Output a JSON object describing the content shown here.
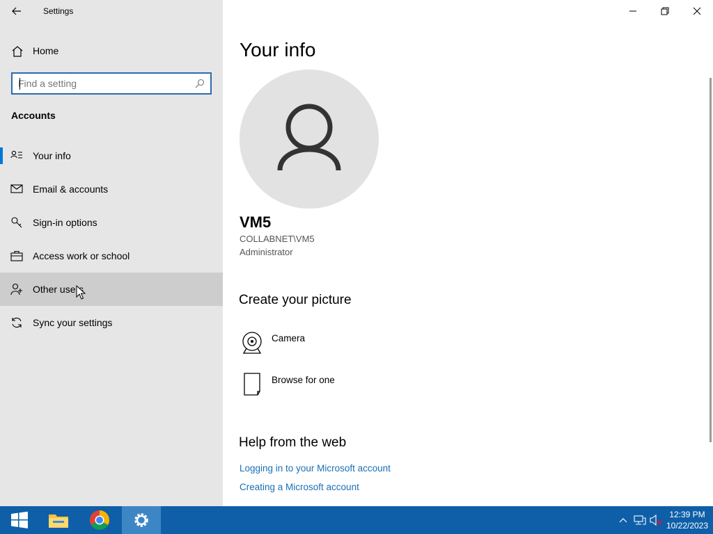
{
  "window": {
    "title": "Settings",
    "minimize_glyph": "—",
    "controls": [
      "minimize-icon",
      "restore-icon",
      "close-icon"
    ]
  },
  "sidebar": {
    "home_label": "Home",
    "search": {
      "placeholder": "Find a setting",
      "value": ""
    },
    "section_title": "Accounts",
    "items": [
      {
        "label": "Your info",
        "icon": "contact-card-icon",
        "selected": true
      },
      {
        "label": "Email & accounts",
        "icon": "mail-icon"
      },
      {
        "label": "Sign-in options",
        "icon": "key-icon"
      },
      {
        "label": "Access work or school",
        "icon": "briefcase-icon"
      },
      {
        "label": "Other users",
        "icon": "person-add-icon",
        "hover": true
      },
      {
        "label": "Sync your settings",
        "icon": "sync-icon"
      }
    ]
  },
  "main": {
    "title": "Your info",
    "user": {
      "name": "VM5",
      "domain": "COLLABNET\\VM5",
      "role": "Administrator"
    },
    "create_picture": {
      "title": "Create your picture",
      "options": [
        {
          "label": "Camera",
          "icon": "camera-icon"
        },
        {
          "label": "Browse for one",
          "icon": "file-icon"
        }
      ]
    },
    "help": {
      "title": "Help from the web",
      "links": [
        "Logging in to your Microsoft account",
        "Creating a Microsoft account"
      ]
    }
  },
  "taskbar": {
    "apps": [
      "start-icon",
      "file-explorer-icon",
      "chrome-icon",
      "settings-icon"
    ],
    "tray": [
      "chevron-up-icon",
      "network-icon",
      "volume-muted-icon"
    ],
    "time": "12:39 PM",
    "date": "10/22/2023"
  },
  "colors": {
    "accent": "#0078d7",
    "sidebar_bg": "#e6e6e6",
    "taskbar_bg": "#0e5fa8",
    "link": "#1a6fb5"
  }
}
